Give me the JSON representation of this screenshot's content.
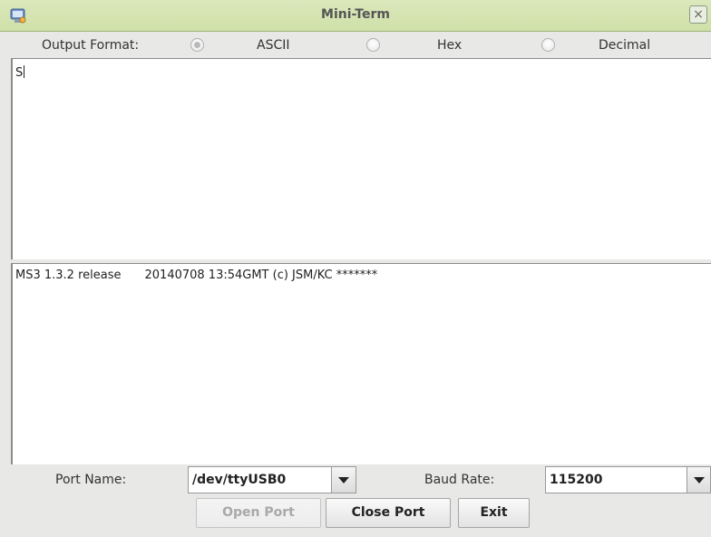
{
  "window": {
    "title": "Mini-Term",
    "close_glyph": "×",
    "app_icon": "terminal-app-icon"
  },
  "format_bar": {
    "label": "Output Format:",
    "options": [
      {
        "label": "ASCII",
        "selected": true
      },
      {
        "label": "Hex",
        "selected": false
      },
      {
        "label": "Decimal",
        "selected": false
      }
    ]
  },
  "input_area": {
    "text": "S"
  },
  "output_area": {
    "line1_a": "MS3 1.3.2 release",
    "line1_b": "20140708 13:54GMT (c) JSM/KC *******"
  },
  "port": {
    "label": "Port Name:",
    "value": "/dev/ttyUSB0",
    "baud_label": "Baud Rate:",
    "baud_value": "115200"
  },
  "buttons": {
    "open_port": "Open Port",
    "open_port_enabled": false,
    "close_port": "Close Port",
    "exit": "Exit"
  }
}
